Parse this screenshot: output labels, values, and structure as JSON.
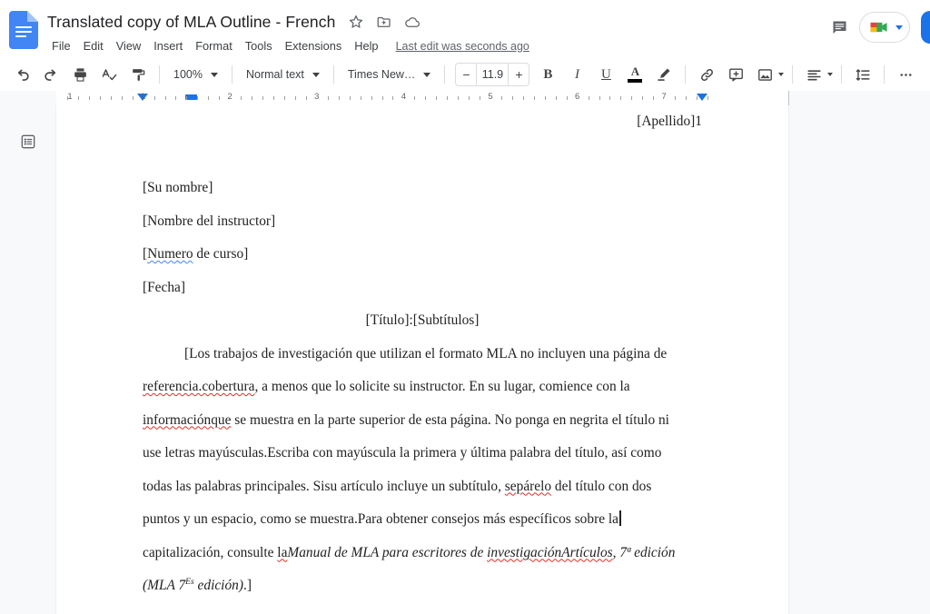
{
  "app": {
    "name": "Google Docs",
    "logo_icon": "google-docs-icon"
  },
  "header": {
    "doc_title": "Translated copy of MLA Outline - French",
    "title_icons": [
      {
        "name": "star-icon",
        "glyph": "star"
      },
      {
        "name": "move-to-folder-icon",
        "glyph": "folder-move"
      },
      {
        "name": "cloud-saved-icon",
        "glyph": "cloud"
      }
    ],
    "menus": [
      "File",
      "Edit",
      "View",
      "Insert",
      "Format",
      "Tools",
      "Extensions",
      "Help"
    ],
    "last_edit": "Last edit was seconds ago",
    "right_actions": {
      "comment_history_icon": "comment-icon",
      "meet_icon": "google-meet-icon",
      "share_label": ""
    }
  },
  "toolbar": {
    "undo_icon": "undo-icon",
    "redo_icon": "redo-icon",
    "print_icon": "print-icon",
    "spellcheck_icon": "spellcheck-icon",
    "paint_format_icon": "paint-format-icon",
    "zoom_value": "100%",
    "style_value": "Normal text",
    "font_value": "Times New…",
    "font_size_value": "11.9",
    "decrease_font_label": "−",
    "increase_font_label": "+",
    "bold_label": "B",
    "italic_label": "I",
    "underline_label": "U",
    "text_color_label": "A",
    "highlight_icon": "highlight-pen-icon",
    "link_icon": "insert-link-icon",
    "comment_icon": "add-comment-icon",
    "image_icon": "insert-image-icon",
    "align_icon": "text-align-icon",
    "line_spacing_icon": "line-spacing-icon",
    "more_icon": "more-options-icon"
  },
  "ruler": {
    "numbers": [
      "1",
      "1",
      "2",
      "3",
      "4",
      "5",
      "6",
      "7"
    ],
    "unit": "inch"
  },
  "sidebar": {
    "outline_icon": "document-outline-icon"
  },
  "document": {
    "header_right": "[Apellido]1",
    "lines": [
      "[Su nombre]",
      "[Nombre del instructor]",
      "[Numero de curso]",
      "[Fecha]"
    ],
    "course_line_plain_prefix": "[",
    "course_line_misspelled": "Numero",
    "course_line_suffix": " de curso]",
    "title_line": "[Título]:[Subtítulos]",
    "body": {
      "l1": "[Los trabajos de investigación que utilizan el formato MLA no incluyen una página de",
      "l2_misspelled": "referencia.cobertura",
      "l2_rest": ", a menos que lo solicite su instructor. En su lugar, comience con la",
      "l3_misspelled": "informaciónque",
      "l3_rest": " se muestra en la parte superior de esta página. No ponga en negrita el título ni",
      "l4": "use letras mayúsculas.Escriba con mayúscula la primera y última palabra del título, así como",
      "l5_pre": "todas las palabras principales. Sisu artículo incluye un subtítulo, ",
      "l5_misspelled": "sepárelo",
      "l5_post": " del título con dos",
      "l6": "puntos y un espacio, como se muestra.Para obtener consejos más específicos sobre la",
      "l7_pre": "capitalización, consulte ",
      "l7_la": "la",
      "l7_ital1": "Manual de MLA para escritores de ",
      "l7_ital_misspelled": "investigaciónArtículos",
      "l7_ital2": ", 7ª edición",
      "l8_pre": "(MLA 7",
      "l8_sup": "Es",
      "l8_post": " edición)",
      "l8_end": ".]"
    }
  },
  "colors": {
    "brand_blue": "#1a73e8",
    "docs_blue": "#4285f4",
    "page_bg": "#f8f9fa",
    "spell_error_red": "#d93025",
    "spell_grammar_blue": "#4285f4",
    "text": "#202124"
  }
}
